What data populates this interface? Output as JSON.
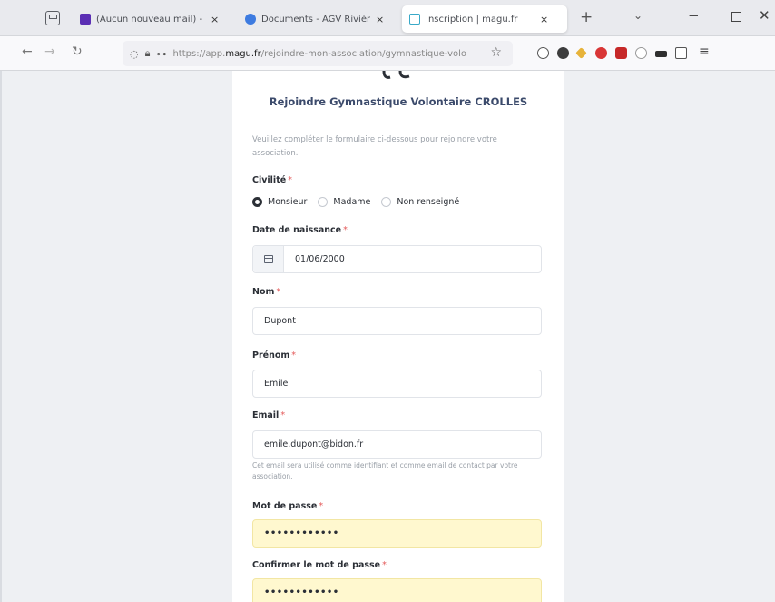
{
  "browser": {
    "tabs": [
      {
        "title": "(Aucun nouveau mail) - jc_ca",
        "close": "×"
      },
      {
        "title": "Documents - AGV Rivière Mor",
        "close": "×"
      },
      {
        "title": "Inscription | magu.fr",
        "close": "×"
      }
    ],
    "new_tab": "+",
    "url_prefix": "https://app.",
    "url_host": "magu.fr",
    "url_path": "/rejoindre-mon-association/gymnastique-volo"
  },
  "form": {
    "title": "Rejoindre Gymnastique Volontaire CROLLES",
    "intro": "Veuillez compléter le formulaire ci-dessous pour rejoindre votre association.",
    "required_mark": "*",
    "civilite": {
      "label": "Civilité",
      "options": [
        "Monsieur",
        "Madame",
        "Non renseigné"
      ],
      "selected": "Monsieur"
    },
    "birthdate": {
      "label": "Date de naissance",
      "value": "01/06/2000"
    },
    "nom": {
      "label": "Nom",
      "value": "Dupont"
    },
    "prenom": {
      "label": "Prénom",
      "value": "Emile"
    },
    "email": {
      "label": "Email",
      "value": "emile.dupont@bidon.fr",
      "help": "Cet email sera utilisé comme identifiant et comme email de contact par votre association."
    },
    "password": {
      "label": "Mot de passe",
      "value": "••••••••••••"
    },
    "password_confirm": {
      "label": "Confirmer le mot de passe",
      "value": "••••••••••••"
    }
  },
  "colors": {
    "title": "#3b4a6b",
    "required": "#e45a5a",
    "autofill": "#fff8cf"
  }
}
